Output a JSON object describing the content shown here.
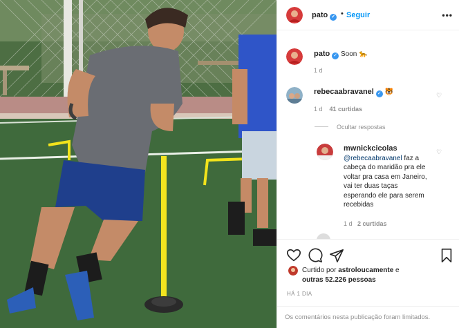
{
  "header": {
    "username": "pato",
    "verified_badge": "✓",
    "separator": "•",
    "follow_label": "Seguir",
    "more_icon": "•••"
  },
  "caption": {
    "username": "pato",
    "text": "Soon",
    "emoji": "🐆",
    "time": "1 d"
  },
  "comments": [
    {
      "username": "rebecaabravanel",
      "emoji": "🐯",
      "time": "1 d",
      "likes": "41 curtidas",
      "hide_replies": "Ocultar respostas"
    },
    {
      "username": "mwnickcicolas",
      "mention": "@rebecaabravanel",
      "text": " faz a cabeça do maridão pra ele voltar pra casa em Janeiro, vai ter duas taças esperando ele para serem recebidas",
      "time": "1 d",
      "likes": "2 curtidas"
    }
  ],
  "actions": {
    "like_icon": "heart-icon",
    "comment_icon": "comment-icon",
    "share_icon": "paper-plane-icon",
    "save_icon": "bookmark-icon"
  },
  "likes": {
    "prefix": "Curtido por ",
    "user": "astroloucamente",
    "middle": " e",
    "others": "outras 52.226 pessoas"
  },
  "time_ago": "HÁ 1 DIA",
  "comments_limited": "Os comentários nesta publicação foram limitados.",
  "colors": {
    "link_blue": "#0095f6",
    "verified_blue": "#3897f0",
    "muted_gray": "#8e8e8e",
    "text": "#262626"
  }
}
